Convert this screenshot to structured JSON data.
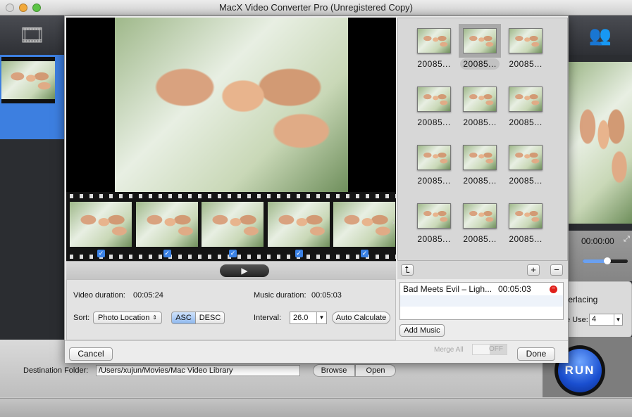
{
  "window": {
    "title": "MacX Video Converter Pro (Unregistered Copy)"
  },
  "colors": {
    "accent": "#3d7fe0",
    "close": "#e0201b",
    "run": "#1a4fd0"
  },
  "sidebar": {
    "add_icon": "film-add-icon"
  },
  "player": {
    "time": "00:00:00",
    "volume": 0.55,
    "people_icon": "people-icon",
    "settings_partial": "terlacing",
    "cpu_use_label": "e Use:",
    "cpu_use_value": "4",
    "merge_all_label": "Merge All",
    "merge_state": "OFF"
  },
  "destination": {
    "label": "Destination Folder:",
    "value": "/Users/xujun/Movies/Mac Video Library",
    "browse": "Browse",
    "open": "Open"
  },
  "run_label": "RUN",
  "dialog": {
    "video_duration_label": "Video duration:",
    "video_duration": "00:05:24",
    "music_duration_label": "Music duration:",
    "music_duration": "00:05:03",
    "sort_label": "Sort:",
    "sort_value": "Photo Location",
    "asc": "ASC",
    "desc": "DESC",
    "sort_selected": "ASC",
    "interval_label": "Interval:",
    "interval_value": "26.0",
    "auto_calculate": "Auto Calculate",
    "cancel": "Cancel",
    "done": "Done",
    "add_music": "Add Music",
    "filmstrip_checked": [
      true,
      true,
      true,
      true,
      true
    ],
    "photos": [
      {
        "label": "20085..."
      },
      {
        "label": "20085...",
        "selected": true
      },
      {
        "label": "20085..."
      },
      {
        "label": "20085..."
      },
      {
        "label": "20085..."
      },
      {
        "label": "20085..."
      },
      {
        "label": "20085..."
      },
      {
        "label": "20085..."
      },
      {
        "label": "20085..."
      },
      {
        "label": "20085..."
      },
      {
        "label": "20085..."
      },
      {
        "label": "20085..."
      }
    ],
    "music": [
      {
        "name": "Bad Meets Evil – Ligh...",
        "duration": "00:05:03"
      }
    ]
  }
}
